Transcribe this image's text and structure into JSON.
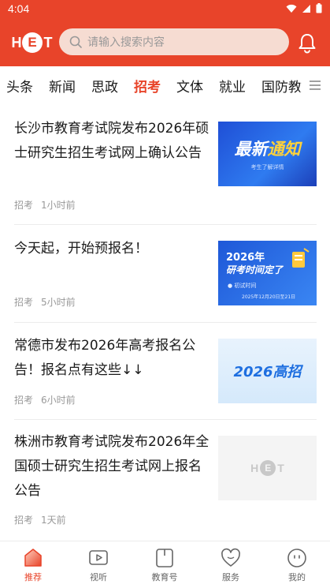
{
  "status_bar": {
    "time": "4:04"
  },
  "header": {
    "logo": {
      "h": "H",
      "e": "E",
      "t": "T"
    },
    "search": {
      "placeholder": "请输入搜索内容"
    }
  },
  "tabs": [
    {
      "label": "头条"
    },
    {
      "label": "新闻"
    },
    {
      "label": "思政"
    },
    {
      "label": "招考",
      "active": true
    },
    {
      "label": "文体"
    },
    {
      "label": "就业"
    },
    {
      "label": "国防教"
    }
  ],
  "articles": [
    {
      "title": "长沙市教育考试院发布2026年硕士研究生招生考试网上确认公告",
      "category": "招考",
      "time": "1小时前",
      "thumb": {
        "line1_white": "最新",
        "line1_yellow": "通知",
        "line2": "考生了解详情"
      }
    },
    {
      "title": "今天起，开始预报名！",
      "category": "招考",
      "time": "5小时前",
      "thumb": {
        "line1": "2026年",
        "line2": "研考时间定了",
        "line3": "● 初试时间",
        "line4": "2025年12月20日至21日"
      }
    },
    {
      "title": "常德市发布2026年高考报名公告！报名点有这些↓↓",
      "category": "招考",
      "time": "6小时前",
      "thumb": {
        "text": "2026高招"
      }
    },
    {
      "title": "株洲市教育考试院发布2026年全国硕士研究生招生考试网上报名公告",
      "category": "招考",
      "time": "1天前",
      "thumb": {
        "h": "H",
        "e": "E",
        "t": "T"
      }
    }
  ],
  "bottom_nav": [
    {
      "label": "推荐",
      "icon": "home-icon",
      "active": true
    },
    {
      "label": "视听",
      "icon": "video-icon"
    },
    {
      "label": "教育号",
      "icon": "book-icon"
    },
    {
      "label": "服务",
      "icon": "heart-icon"
    },
    {
      "label": "我的",
      "icon": "profile-icon"
    }
  ],
  "colors": {
    "accent": "#e8442a",
    "header_bg": "#e8442a",
    "muted_text": "#999999"
  }
}
